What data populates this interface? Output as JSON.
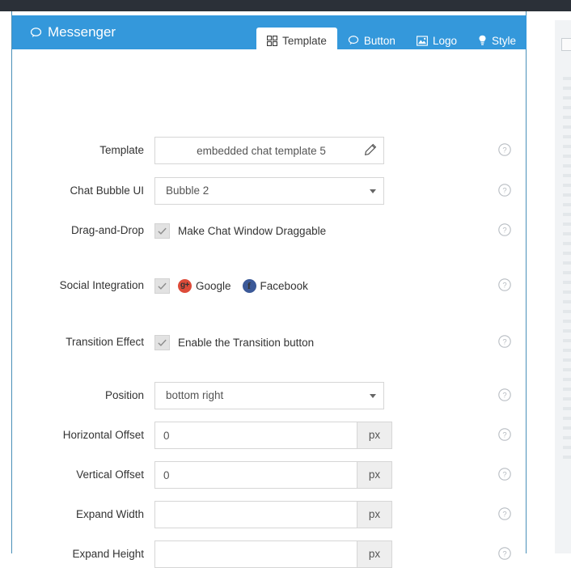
{
  "header": {
    "brand": "Messenger",
    "brand_icon": "speech-bubble-icon",
    "accent_color": "#3498db",
    "tabs": [
      {
        "label": "Template",
        "icon": "grid-icon",
        "active": true
      },
      {
        "label": "Button",
        "icon": "speech-bubble-icon",
        "active": false
      },
      {
        "label": "Logo",
        "icon": "picture-icon",
        "active": false
      },
      {
        "label": "Style",
        "icon": "lightbulb-icon",
        "active": false
      }
    ]
  },
  "form": {
    "help_icon": "question-mark-icon",
    "rows": [
      {
        "label": "Template",
        "type": "text-edit",
        "value": "embedded chat template 5",
        "placeholder": "",
        "icon": "pencil-icon",
        "help": true
      },
      {
        "label": "Chat Bubble UI",
        "type": "select",
        "value": "Bubble 2",
        "icon": "chevron-down-icon",
        "help": true
      },
      {
        "label": "Drag-and-Drop",
        "type": "checkbox",
        "checked": true,
        "text": "Make Chat Window Draggable",
        "help": true
      },
      {
        "label": "Social Integration",
        "type": "checkbox-social",
        "checked": true,
        "social": [
          {
            "name": "Google",
            "icon": "google-plus-icon",
            "color": "#dd4b39",
            "glyph": "g+"
          },
          {
            "name": "Facebook",
            "icon": "facebook-icon",
            "color": "#3b5998",
            "glyph": "f"
          }
        ],
        "help": true
      },
      {
        "label": "Transition Effect",
        "type": "checkbox",
        "checked": true,
        "text": "Enable the Transition button",
        "help": true
      },
      {
        "label": "Position",
        "type": "select",
        "value": "bottom right",
        "icon": "chevron-down-icon",
        "help": true
      },
      {
        "label": "Horizontal Offset",
        "type": "text-unit",
        "value": "0",
        "unit": "px",
        "help": true
      },
      {
        "label": "Vertical Offset",
        "type": "text-unit",
        "value": "0",
        "unit": "px",
        "help": true
      },
      {
        "label": "Expand Width",
        "type": "text-unit",
        "value": "",
        "unit": "px",
        "help": true
      },
      {
        "label": "Expand Height",
        "type": "text-unit",
        "value": "",
        "unit": "px",
        "help": true
      }
    ]
  }
}
